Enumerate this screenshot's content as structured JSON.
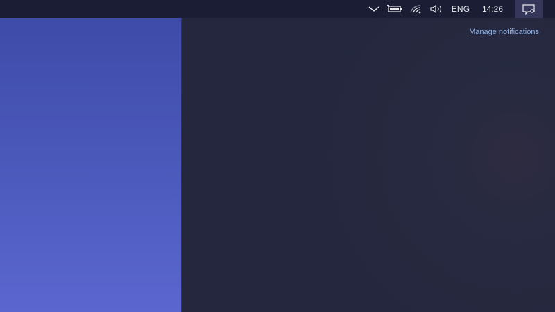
{
  "taskbar": {
    "tray_icons": [
      "chevron-up-icon",
      "battery-icon",
      "wifi-icon",
      "volume-icon"
    ],
    "language": "ENG",
    "time": "14:26",
    "action_center_icon": "notification-icon"
  },
  "notification_panel": {
    "manage_label": "Manage notifications"
  },
  "colors": {
    "taskbar_bg": "#1b1d34",
    "panel_bg": "#24273d",
    "wallpaper_top": "#3f4ba8",
    "wallpaper_bottom": "#5b67cf",
    "link": "#8fb0e3"
  }
}
